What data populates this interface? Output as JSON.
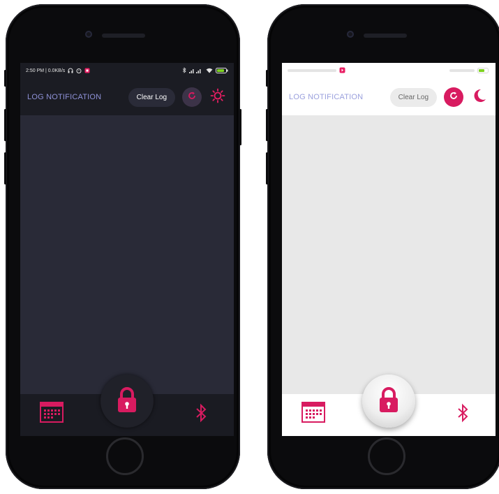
{
  "accent_color": "#d81b60",
  "screens": {
    "dark": {
      "theme": "dark",
      "status_bar": {
        "time_and_speed": "2:50 PM | 0.0KB/s"
      },
      "app_bar": {
        "title": "LOG NOTIFICATION",
        "clear_button_label": "Clear Log",
        "refresh_icon": "refresh-icon",
        "theme_toggle_icon": "sun-icon"
      },
      "bottom_nav": {
        "left_icon": "calendar-icon",
        "center_icon": "lock-icon",
        "right_icon": "bluetooth-icon"
      }
    },
    "light": {
      "theme": "light",
      "app_bar": {
        "title": "LOG NOTIFICATION",
        "clear_button_label": "Clear Log",
        "refresh_icon": "refresh-icon",
        "theme_toggle_icon": "moon-icon"
      },
      "bottom_nav": {
        "left_icon": "calendar-icon",
        "center_icon": "lock-icon",
        "right_icon": "bluetooth-icon"
      }
    }
  }
}
